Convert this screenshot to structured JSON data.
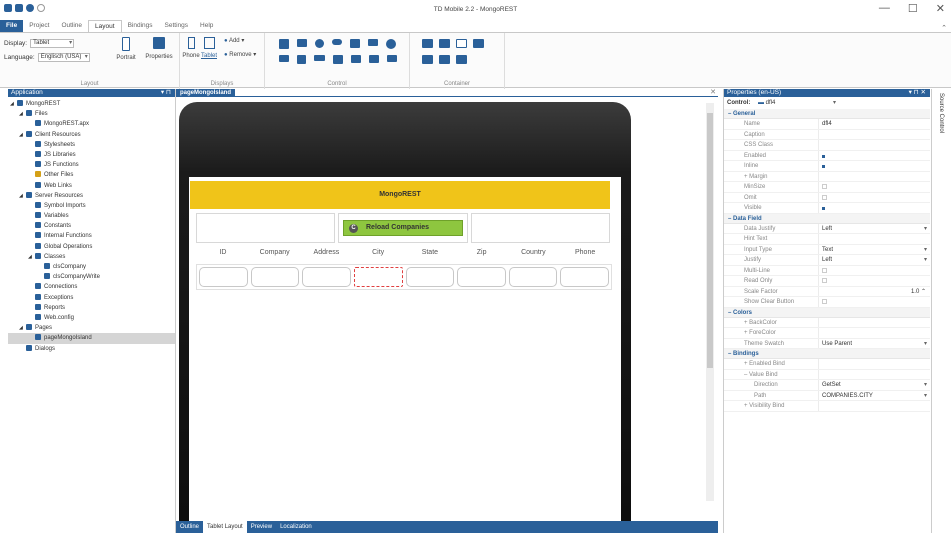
{
  "window": {
    "title": "TD Mobile 2.2 - MongoREST",
    "controls": [
      "—",
      "☐",
      "✕"
    ]
  },
  "ribbon": {
    "tabs": [
      "File",
      "Project",
      "Outline",
      "Layout",
      "Bindings",
      "Settings",
      "Help"
    ],
    "active_tab": "Layout",
    "display_label": "Display:",
    "display_value": "Tablet",
    "language_label": "Language:",
    "language_value": "Englisch (USA)",
    "portrait_label": "Portrait",
    "properties_label": "Properties",
    "phone_label": "Phone",
    "tablet_label": "Tablet",
    "add_label": "Add",
    "remove_label": "Remove",
    "groups": {
      "layout": "Layout",
      "displays": "Displays",
      "control": "Control",
      "container": "Container"
    }
  },
  "application": {
    "header": "Application",
    "pin": "▾ ⊓",
    "tree": [
      {
        "label": "MongoREST",
        "level": 0,
        "twisty": "◢",
        "color": "#2a6099"
      },
      {
        "label": "Files",
        "level": 1,
        "twisty": "◢",
        "color": "#2a6099"
      },
      {
        "label": "MongoREST.apx",
        "level": 2,
        "twisty": "",
        "color": "#2a6099"
      },
      {
        "label": "Client Resources",
        "level": 1,
        "twisty": "◢",
        "color": "#2a6099"
      },
      {
        "label": "Stylesheets",
        "level": 2,
        "twisty": "",
        "color": "#2a6099"
      },
      {
        "label": "JS Libraries",
        "level": 2,
        "twisty": "",
        "color": "#2a6099"
      },
      {
        "label": "JS Functions",
        "level": 2,
        "twisty": "",
        "color": "#2a6099"
      },
      {
        "label": "Other Files",
        "level": 2,
        "twisty": "",
        "color": "#d4a017"
      },
      {
        "label": "Web Links",
        "level": 2,
        "twisty": "",
        "color": "#2a6099"
      },
      {
        "label": "Server Resources",
        "level": 1,
        "twisty": "◢",
        "color": "#2a6099"
      },
      {
        "label": "Symbol Imports",
        "level": 2,
        "twisty": "",
        "color": "#2a6099"
      },
      {
        "label": "Variables",
        "level": 2,
        "twisty": "",
        "color": "#2a6099"
      },
      {
        "label": "Constants",
        "level": 2,
        "twisty": "",
        "color": "#2a6099"
      },
      {
        "label": "Internal Functions",
        "level": 2,
        "twisty": "",
        "color": "#2a6099"
      },
      {
        "label": "Global Operations",
        "level": 2,
        "twisty": "",
        "color": "#2a6099"
      },
      {
        "label": "Classes",
        "level": 2,
        "twisty": "◢",
        "color": "#2a6099"
      },
      {
        "label": "clsCompany",
        "level": 3,
        "twisty": "",
        "color": "#2a6099"
      },
      {
        "label": "clsCompanyWrite",
        "level": 3,
        "twisty": "",
        "color": "#2a6099"
      },
      {
        "label": "Connections",
        "level": 2,
        "twisty": "",
        "color": "#2a6099"
      },
      {
        "label": "Exceptions",
        "level": 2,
        "twisty": "",
        "color": "#2a6099"
      },
      {
        "label": "Reports",
        "level": 2,
        "twisty": "",
        "color": "#2a6099"
      },
      {
        "label": "Web.config",
        "level": 2,
        "twisty": "",
        "color": "#2a6099"
      },
      {
        "label": "Pages",
        "level": 1,
        "twisty": "◢",
        "color": "#2a6099"
      },
      {
        "label": "pageMongoIsland",
        "level": 2,
        "twisty": "",
        "color": "#2a6099",
        "selected": true
      },
      {
        "label": "Dialogs",
        "level": 1,
        "twisty": "",
        "color": "#2a6099"
      }
    ]
  },
  "designer": {
    "tab": "pageMongoIsland",
    "close": "✕",
    "app_header": "MongoREST",
    "reload_button": "Reload Companies",
    "reload_icon": "C",
    "columns": [
      "ID",
      "Company",
      "Address",
      "City",
      "State",
      "Zip",
      "Country",
      "Phone"
    ],
    "bottom_tabs": [
      "Outline",
      "Tablet Layout",
      "Preview",
      "Localization"
    ],
    "active_bottom_tab": "Tablet Layout"
  },
  "properties": {
    "header": "Properties (en-US)",
    "header_icons": "▾ ⊓ ✕",
    "control_label": "Control:",
    "control_value": "dfl4",
    "categories": [
      {
        "name": "General",
        "rows": [
          {
            "name": "Name",
            "value": "dfl4",
            "type": "text"
          },
          {
            "name": "Caption",
            "value": "",
            "type": "text"
          },
          {
            "name": "CSS Class",
            "value": "",
            "type": "text"
          },
          {
            "name": "Enabled",
            "value": "",
            "type": "check-on"
          },
          {
            "name": "Inline",
            "value": "",
            "type": "check-on"
          },
          {
            "name": "+ Margin",
            "value": "",
            "type": "text"
          },
          {
            "name": "MinSize",
            "value": "",
            "type": "check"
          },
          {
            "name": "Omit",
            "value": "",
            "type": "check"
          },
          {
            "name": "Visible",
            "value": "",
            "type": "check-on"
          }
        ]
      },
      {
        "name": "Data Field",
        "rows": [
          {
            "name": "Data Justify",
            "value": "Left",
            "type": "dd"
          },
          {
            "name": "Hint Text",
            "value": "",
            "type": "text"
          },
          {
            "name": "Input Type",
            "value": "Text",
            "type": "dd"
          },
          {
            "name": "Justify",
            "value": "Left",
            "type": "dd"
          },
          {
            "name": "Multi-Line",
            "value": "",
            "type": "check"
          },
          {
            "name": "Read Only",
            "value": "",
            "type": "check"
          },
          {
            "name": "Scale Factor",
            "value": "1.0 ⌃",
            "type": "num"
          },
          {
            "name": "Show Clear Button",
            "value": "",
            "type": "check"
          }
        ]
      },
      {
        "name": "Colors",
        "rows": [
          {
            "name": "+ BackColor",
            "value": "",
            "type": "text"
          },
          {
            "name": "+ ForeColor",
            "value": "",
            "type": "text"
          },
          {
            "name": "Theme Swatch",
            "value": "Use Parent",
            "type": "dd"
          }
        ]
      },
      {
        "name": "Bindings",
        "rows": [
          {
            "name": "+ Enabled Bind",
            "value": "",
            "type": "text"
          },
          {
            "name": "– Value Bind",
            "value": "",
            "type": "text"
          },
          {
            "name": "Direction",
            "value": "GetSet",
            "type": "dd",
            "sub": true
          },
          {
            "name": "Path",
            "value": "COMPANIES.CITY",
            "type": "dd",
            "sub": true
          },
          {
            "name": "+ Visibility Bind",
            "value": "",
            "type": "text"
          }
        ]
      }
    ]
  },
  "source_control": "Source Control",
  "colors": {
    "accent": "#2a6099",
    "app_header": "#f0c419",
    "reload": "#8ec63f"
  }
}
